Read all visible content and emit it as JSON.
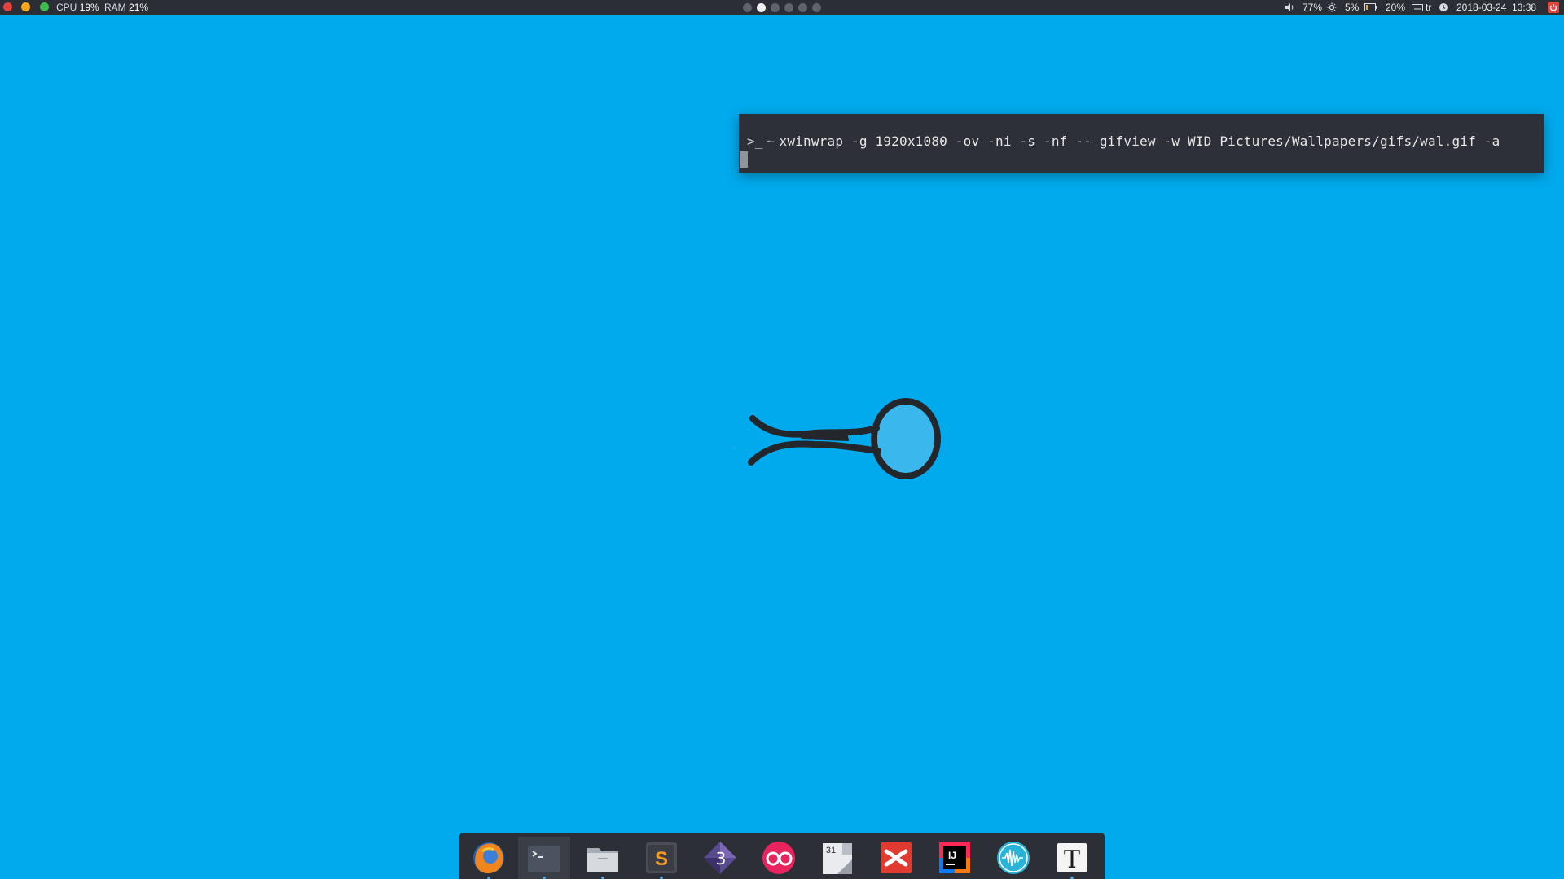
{
  "topbar": {
    "window_buttons": [
      {
        "name": "close",
        "color": "#e0443e"
      },
      {
        "name": "minimize",
        "color": "#f5a623"
      },
      {
        "name": "maximize",
        "color": "#3fb950"
      }
    ],
    "cpu_label": "CPU",
    "cpu_value": "19%",
    "ram_label": "RAM",
    "ram_value": "21%",
    "workspaces": {
      "count": 6,
      "active_index": 1
    },
    "tray": {
      "volume": "77%",
      "brightness": "5%",
      "battery": "20%",
      "keyboard_layout": "tr",
      "datetime": "2018-03-24  13:38"
    }
  },
  "terminal": {
    "prompt": ">_",
    "cwd": "~",
    "command": "xwinwrap -g 1920x1080 -ov -ni -s -nf -- gifview -w WID Pictures/Wallpapers/gifs/wal.gif -a"
  },
  "dock": {
    "items": [
      {
        "name": "firefox",
        "icon": "firefox-icon",
        "running": true,
        "focused": false
      },
      {
        "name": "terminal",
        "icon": "terminal-icon",
        "running": true,
        "focused": true
      },
      {
        "name": "files",
        "icon": "folder-icon",
        "running": true,
        "focused": false
      },
      {
        "name": "sublime-text",
        "icon": "sublime-text-icon",
        "running": true,
        "focused": false
      },
      {
        "name": "app-3",
        "icon": "gem-3-icon",
        "running": false,
        "focused": false
      },
      {
        "name": "flickr",
        "icon": "flickr-icon",
        "running": false,
        "focused": false
      },
      {
        "name": "calendar",
        "icon": "calendar-icon",
        "label": "31",
        "running": false,
        "focused": false
      },
      {
        "name": "xmind",
        "icon": "xmind-icon",
        "running": false,
        "focused": false
      },
      {
        "name": "intellij",
        "icon": "intellij-icon",
        "label": "IJ",
        "running": false,
        "focused": false
      },
      {
        "name": "audio",
        "icon": "waveform-icon",
        "running": false,
        "focused": false
      },
      {
        "name": "typora",
        "icon": "typora-icon",
        "label": "T",
        "running": true,
        "focused": false
      }
    ]
  },
  "colors": {
    "desktop": "#00aaed",
    "bar": "#2b2e35",
    "terminal": "#2e3039",
    "dock": "#2c2f36"
  }
}
